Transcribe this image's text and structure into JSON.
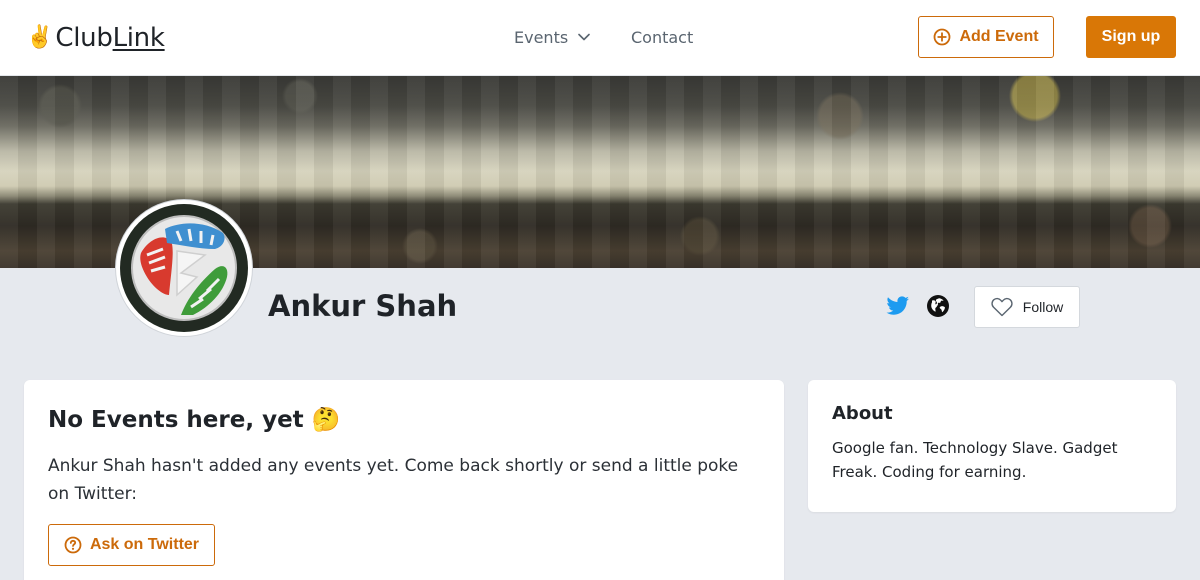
{
  "header": {
    "logo_emoji": "✌️",
    "logo_club": "Club",
    "logo_link": "Link",
    "nav_events_label": "Events",
    "nav_contact_label": "Contact",
    "add_event_label": "Add Event",
    "signup_label": "Sign up"
  },
  "profile": {
    "name": "Ankur Shah",
    "follow_label": "Follow",
    "social_icons": [
      "twitter-icon",
      "globe-icon"
    ]
  },
  "events": {
    "title": "No Events here, yet 🤔",
    "description": "Ankur Shah hasn't added any events yet. Come back shortly or send a little poke on Twitter:",
    "ask_button_label": "Ask on Twitter"
  },
  "about": {
    "title": "About",
    "text": "Google fan. Technology Slave. Gadget Freak. Coding for earning."
  },
  "colors": {
    "accent": "#d97706",
    "accent_outline": "#cc6a0a",
    "twitter": "#1d9bf0",
    "page_bg": "#e6e9ee"
  }
}
